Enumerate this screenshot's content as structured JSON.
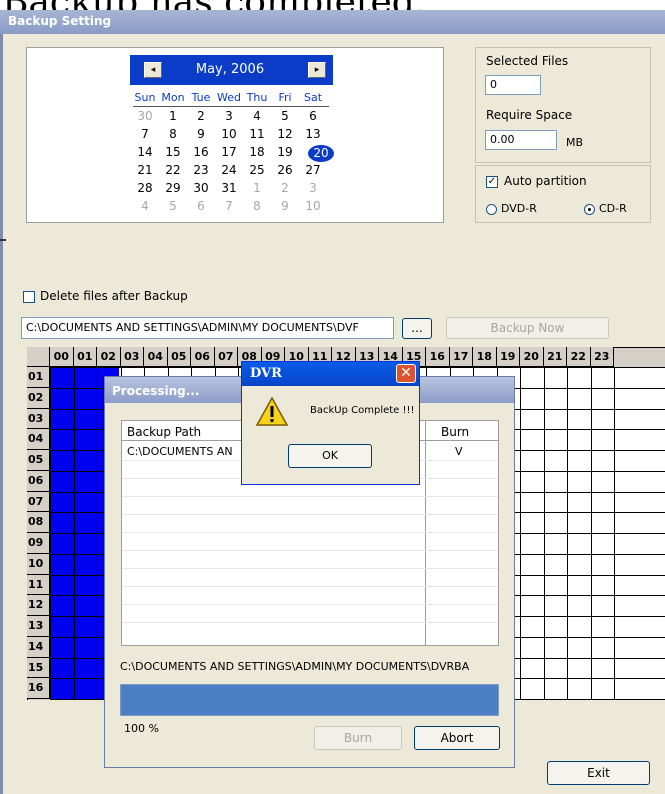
{
  "caption": "Backup has completed.",
  "window": {
    "title": "Backup Setting"
  },
  "calendar": {
    "month_label": "May, 2006",
    "prev": "◂",
    "next": "▸",
    "days_of_week": [
      "Sun",
      "Mon",
      "Tue",
      "Wed",
      "Thu",
      "Fri",
      "Sat"
    ],
    "weeks": [
      [
        "30",
        "1",
        "2",
        "3",
        "4",
        "5",
        "6"
      ],
      [
        "7",
        "8",
        "9",
        "10",
        "11",
        "12",
        "13"
      ],
      [
        "14",
        "15",
        "16",
        "17",
        "18",
        "19",
        "20"
      ],
      [
        "21",
        "22",
        "23",
        "24",
        "25",
        "26",
        "27"
      ],
      [
        "28",
        "29",
        "30",
        "31",
        "1",
        "2",
        "3"
      ],
      [
        "4",
        "5",
        "6",
        "7",
        "8",
        "9",
        "10"
      ]
    ],
    "selected_day": "20"
  },
  "selection": {
    "selected_files_label": "Selected Files",
    "selected_files_value": "0",
    "require_space_label": "Require Space",
    "require_space_value": "0.00",
    "unit": "MB"
  },
  "partition": {
    "auto_label": "Auto partition",
    "auto_checked": true,
    "dvd_label": "DVD-R",
    "cd_label": "CD-R",
    "selected": "CD-R"
  },
  "options": {
    "delete_after_label": "Delete files after Backup",
    "delete_after_checked": false
  },
  "path": {
    "value": "C:\\DOCUMENTS AND SETTINGS\\ADMIN\\MY DOCUMENTS\\DVF",
    "browse_label": "...",
    "backup_now_label": "Backup Now"
  },
  "grid": {
    "hours": [
      "00",
      "01",
      "02",
      "03",
      "04",
      "05",
      "06",
      "07",
      "08",
      "09",
      "10",
      "11",
      "12",
      "13",
      "14",
      "15",
      "16",
      "17",
      "18",
      "19",
      "20",
      "21",
      "22",
      "23"
    ],
    "rows": [
      "01",
      "02",
      "03",
      "04",
      "05",
      "06",
      "07",
      "08",
      "09",
      "10",
      "11",
      "12",
      "13",
      "14",
      "15",
      "16"
    ]
  },
  "processing": {
    "title": "Processing...",
    "col_path": "Backup Path",
    "col_burn": "Burn",
    "rows": [
      {
        "path": "C:\\DOCUMENTS AN",
        "burn": "V"
      }
    ],
    "dest_path": "C:\\DOCUMENTS AND SETTINGS\\ADMIN\\MY DOCUMENTS\\DVRBA",
    "progress_percent": 100,
    "percent_label": "100  %",
    "burn_label": "Burn",
    "abort_label": "Abort"
  },
  "dvr_dialog": {
    "title": "DVR",
    "message": "BackUp Complete !!!",
    "ok_label": "OK",
    "close_glyph": "✕"
  },
  "exit_label": "Exit"
}
